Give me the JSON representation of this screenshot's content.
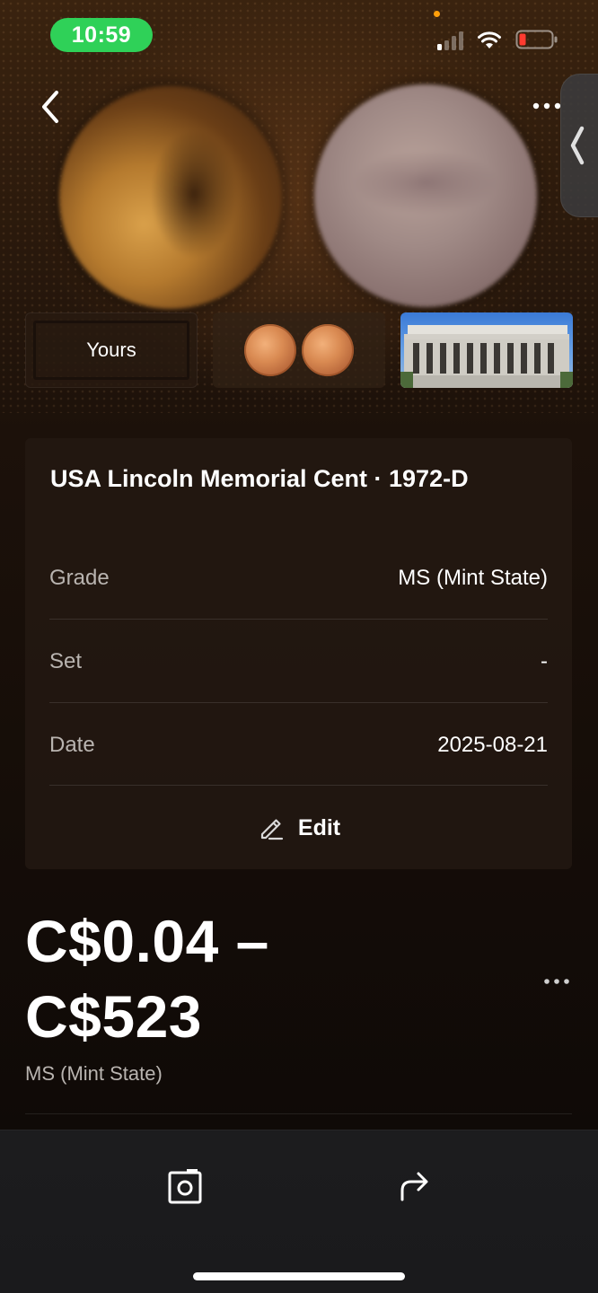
{
  "status_bar": {
    "time": "10:59",
    "signal_bars_active": 1,
    "signal_bars_total": 4,
    "battery_level": "low",
    "battery_color": "#ff3b30",
    "time_pill_color": "#2fd158",
    "icons": [
      "signal-icon",
      "wifi-icon",
      "battery-icon"
    ]
  },
  "nav": {
    "back_icon": "chevron-left-icon",
    "more_icon": "more-horizontal-icon",
    "side_tab_icon": "chevron-left-icon"
  },
  "gallery": {
    "images": [
      "coin-obverse",
      "coin-reverse"
    ],
    "thumbnails": [
      {
        "label": "Yours",
        "selected": true
      },
      {
        "label": "",
        "kind": "reference-coins"
      },
      {
        "label": "",
        "kind": "lincoln-memorial"
      }
    ]
  },
  "coin_info": {
    "title": "USA Lincoln Memorial Cent · 1972-D",
    "rows": [
      {
        "label": "Grade",
        "value": "MS (Mint State)"
      },
      {
        "label": "Set",
        "value": "-"
      },
      {
        "label": "Date",
        "value": "2025-08-21"
      }
    ],
    "edit_label": "Edit",
    "edit_icon": "pencil-icon"
  },
  "valuation": {
    "price_line1": "C$0.04 –",
    "price_line2": "C$523",
    "grade": "MS (Mint State)",
    "more_icon": "more-horizontal-icon"
  },
  "bottom_bar": {
    "camera_icon": "camera-icon",
    "share_icon": "share-icon"
  }
}
